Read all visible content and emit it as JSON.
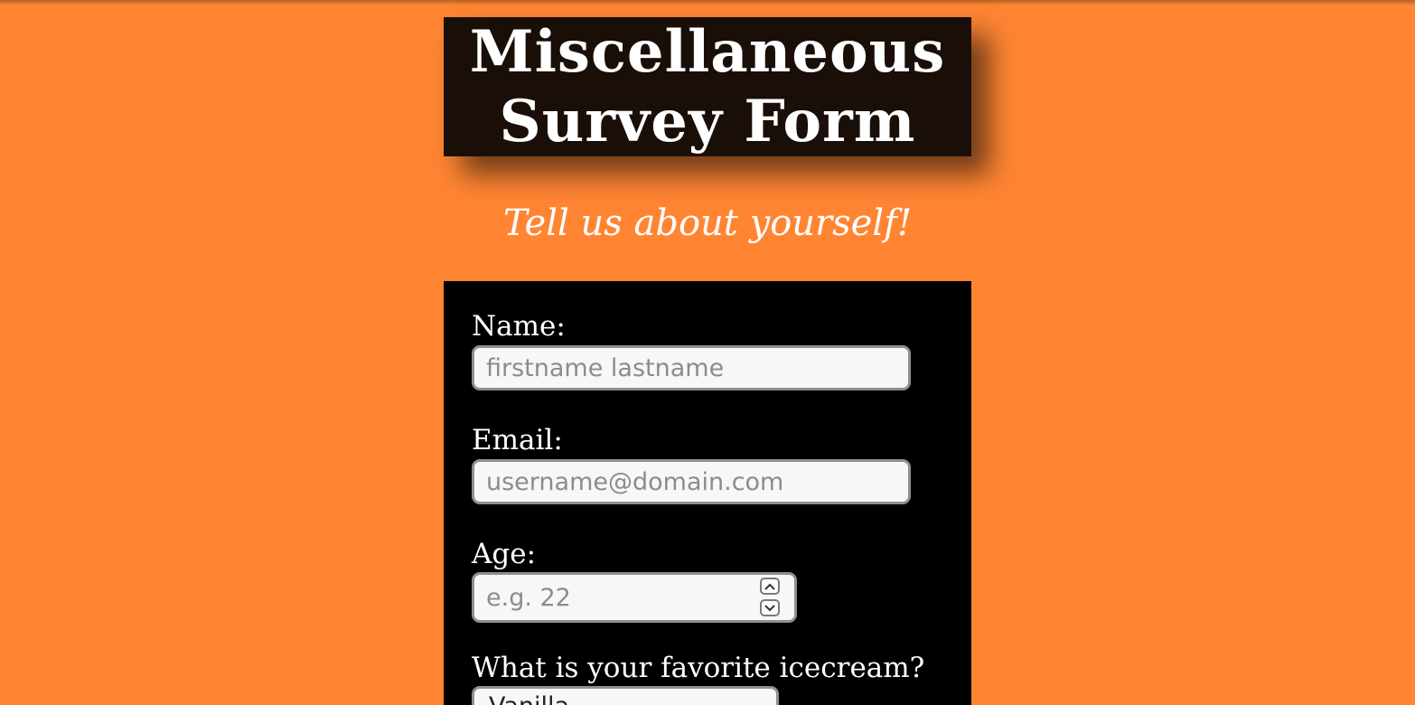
{
  "header": {
    "title_line1": "Miscellaneous",
    "title_line2": "Survey Form",
    "subtitle": "Tell us about yourself!"
  },
  "form": {
    "name": {
      "label": "Name:",
      "placeholder": "firstname lastname"
    },
    "email": {
      "label": "Email:",
      "placeholder": "username@domain.com"
    },
    "age": {
      "label": "Age:",
      "placeholder": "e.g. 22"
    },
    "icecream": {
      "label": "What is your favorite icecream?",
      "selected": "Vanilla"
    }
  },
  "colors": {
    "background": "#FF8533",
    "title_box": "#1a0f08",
    "form_box": "#000000",
    "text": "#ffffff"
  },
  "icons": {
    "spin_up": "chevron-up-icon",
    "spin_down": "chevron-down-icon"
  }
}
